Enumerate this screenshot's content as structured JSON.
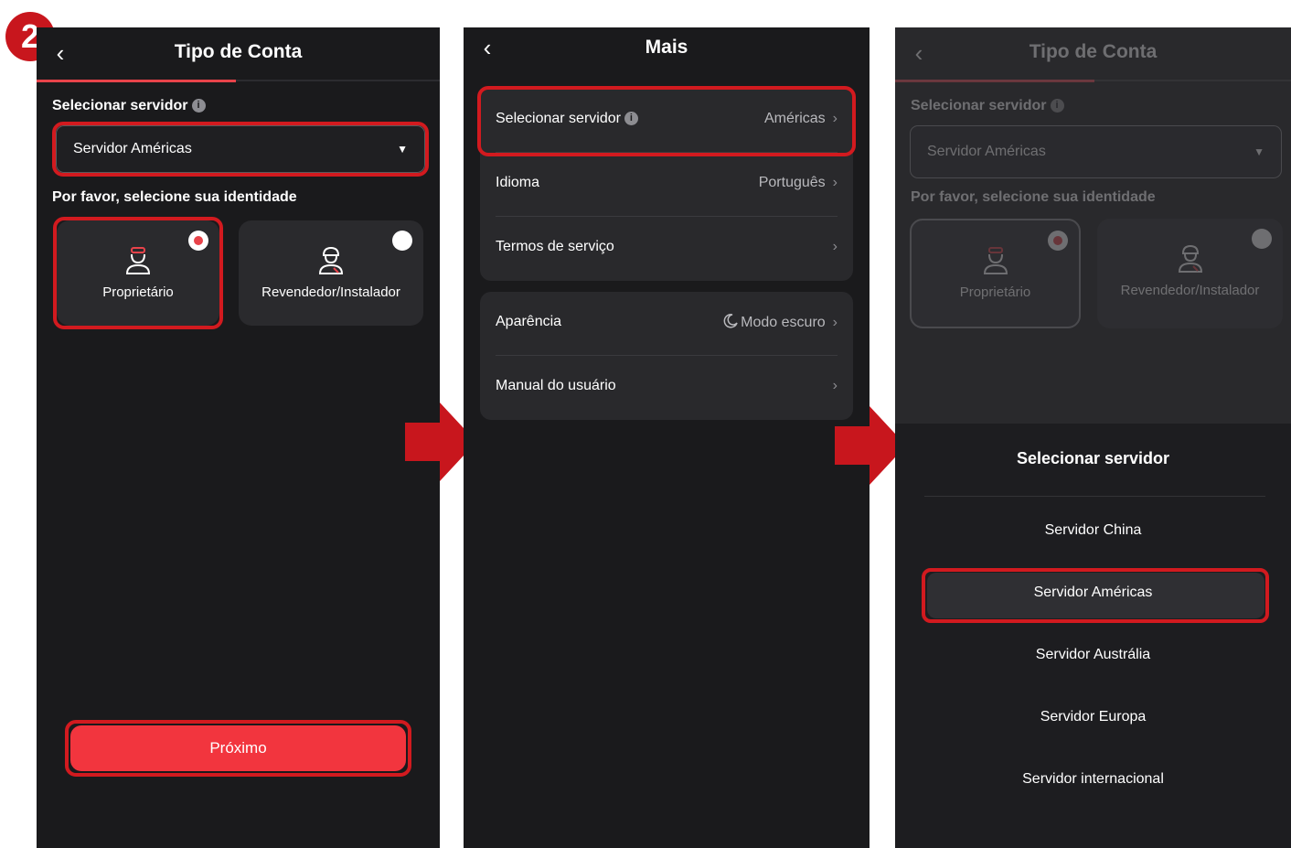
{
  "step_number": "2",
  "colors": {
    "accent": "#f2353e",
    "highlight": "#d21a1f",
    "panel_bg": "#1a1a1c",
    "card_bg": "#2a2a2d"
  },
  "screen1": {
    "title": "Tipo de Conta",
    "server_label": "Selecionar servidor",
    "server_value": "Servidor Américas",
    "identity_label": "Por favor, selecione sua identidade",
    "owner": "Proprietário",
    "reseller": "Revendedor/Instalador",
    "next_button": "Próximo"
  },
  "screen2": {
    "title": "Mais",
    "rows": [
      {
        "label": "Selecionar servidor",
        "value": "Américas"
      },
      {
        "label": "Idioma",
        "value": "Português"
      },
      {
        "label": "Termos de serviço",
        "value": ""
      },
      {
        "label": "Aparência",
        "value": "Modo escuro"
      },
      {
        "label": "Manual do usuário",
        "value": ""
      }
    ]
  },
  "screen3": {
    "title": "Tipo de Conta",
    "server_label": "Selecionar servidor",
    "server_value": "Servidor Américas",
    "identity_label": "Por favor, selecione sua identidade",
    "owner": "Proprietário",
    "reseller": "Revendedor/Instalador",
    "sheet_title": "Selecionar servidor",
    "options": [
      "Servidor China",
      "Servidor Américas",
      "Servidor Austrália",
      "Servidor Europa",
      "Servidor internacional"
    ]
  },
  "icons": {
    "back": "chevron-left-icon",
    "info": "info-icon",
    "caret": "caret-down-icon",
    "owner": "person-icon",
    "reseller": "installer-icon",
    "moon": "moon-icon",
    "chevron": "chevron-right-icon"
  }
}
